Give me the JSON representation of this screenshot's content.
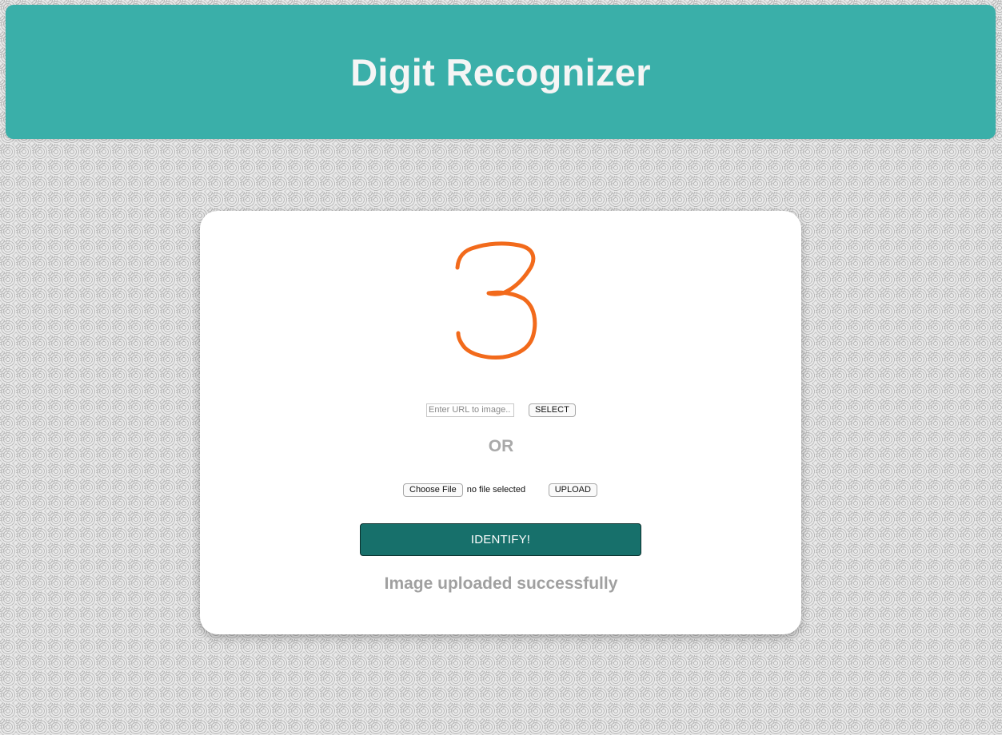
{
  "header": {
    "title": "Digit Recognizer"
  },
  "preview": {
    "digit_image": "handwritten-digit-3",
    "stroke_color": "#f26a1b"
  },
  "url_form": {
    "placeholder": "Enter URL to image..",
    "value": "",
    "select_label": "SELECT"
  },
  "separator": {
    "text": "OR"
  },
  "file_form": {
    "choose_label": "Choose File",
    "file_status": "no file selected",
    "upload_label": "UPLOAD"
  },
  "identify_button": {
    "label": "IDENTIFY!"
  },
  "status_message": "Image uploaded successfully",
  "colors": {
    "header_bg": "#3aafa9",
    "button_bg": "#17706b",
    "muted_text": "#a0a0a0"
  }
}
